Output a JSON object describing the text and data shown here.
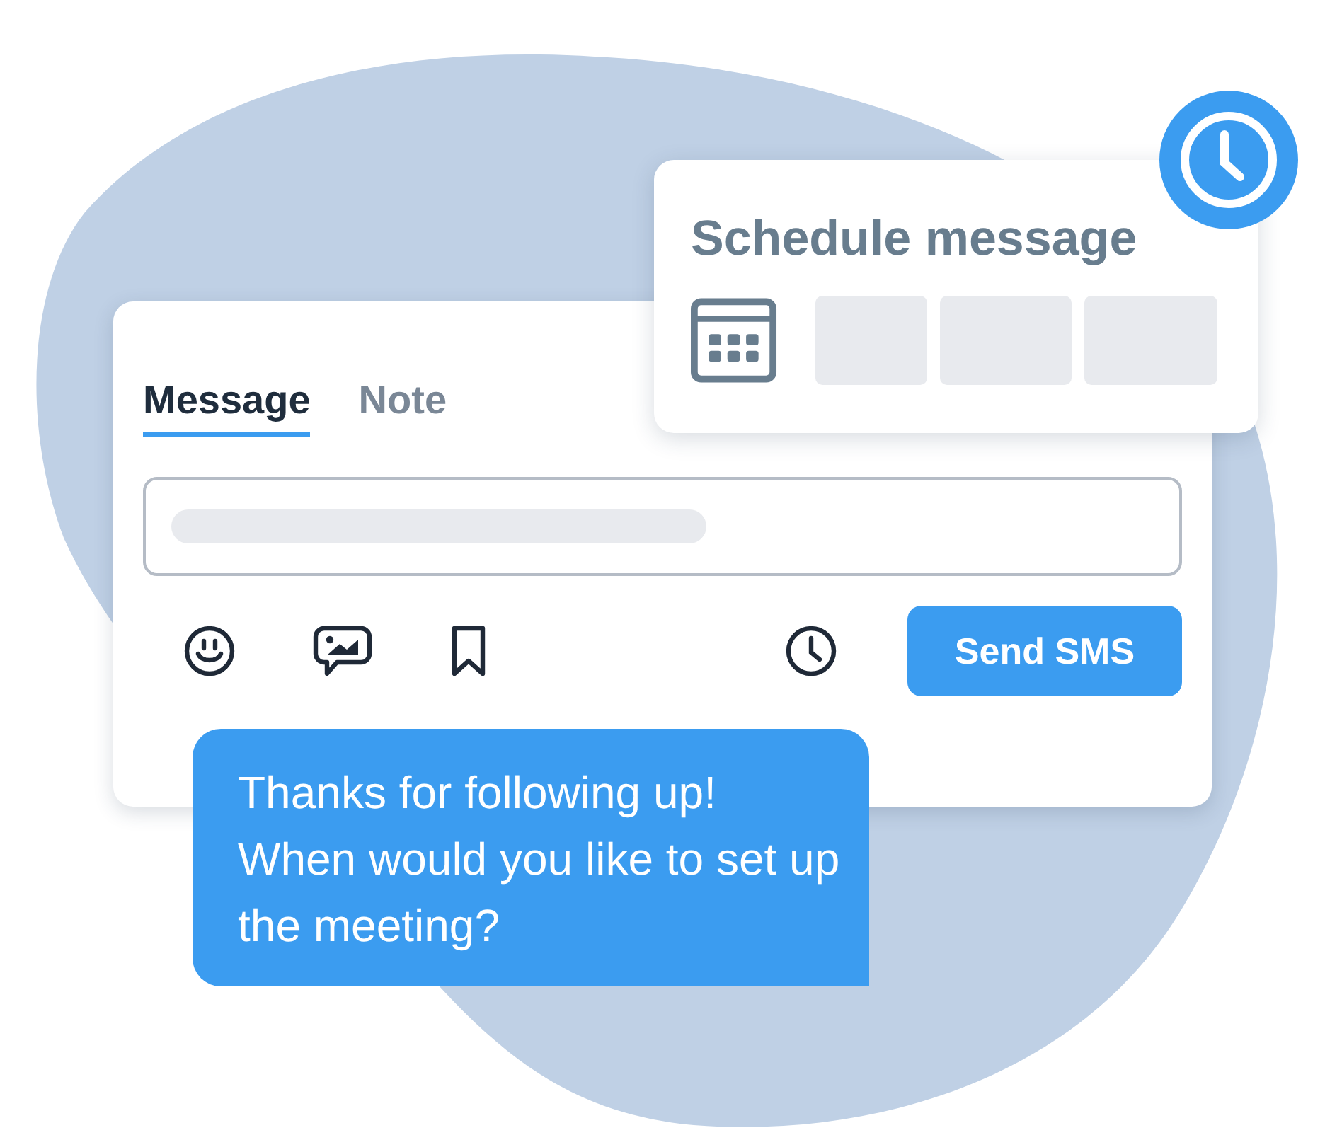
{
  "composer": {
    "tabs": [
      {
        "label": "Message",
        "selected": true
      },
      {
        "label": "Note",
        "selected": false
      }
    ],
    "send_button": "Send SMS"
  },
  "schedule": {
    "title": "Schedule message"
  },
  "bubble": {
    "text": "Thanks for following up! When would you like to set up the meeting?"
  }
}
